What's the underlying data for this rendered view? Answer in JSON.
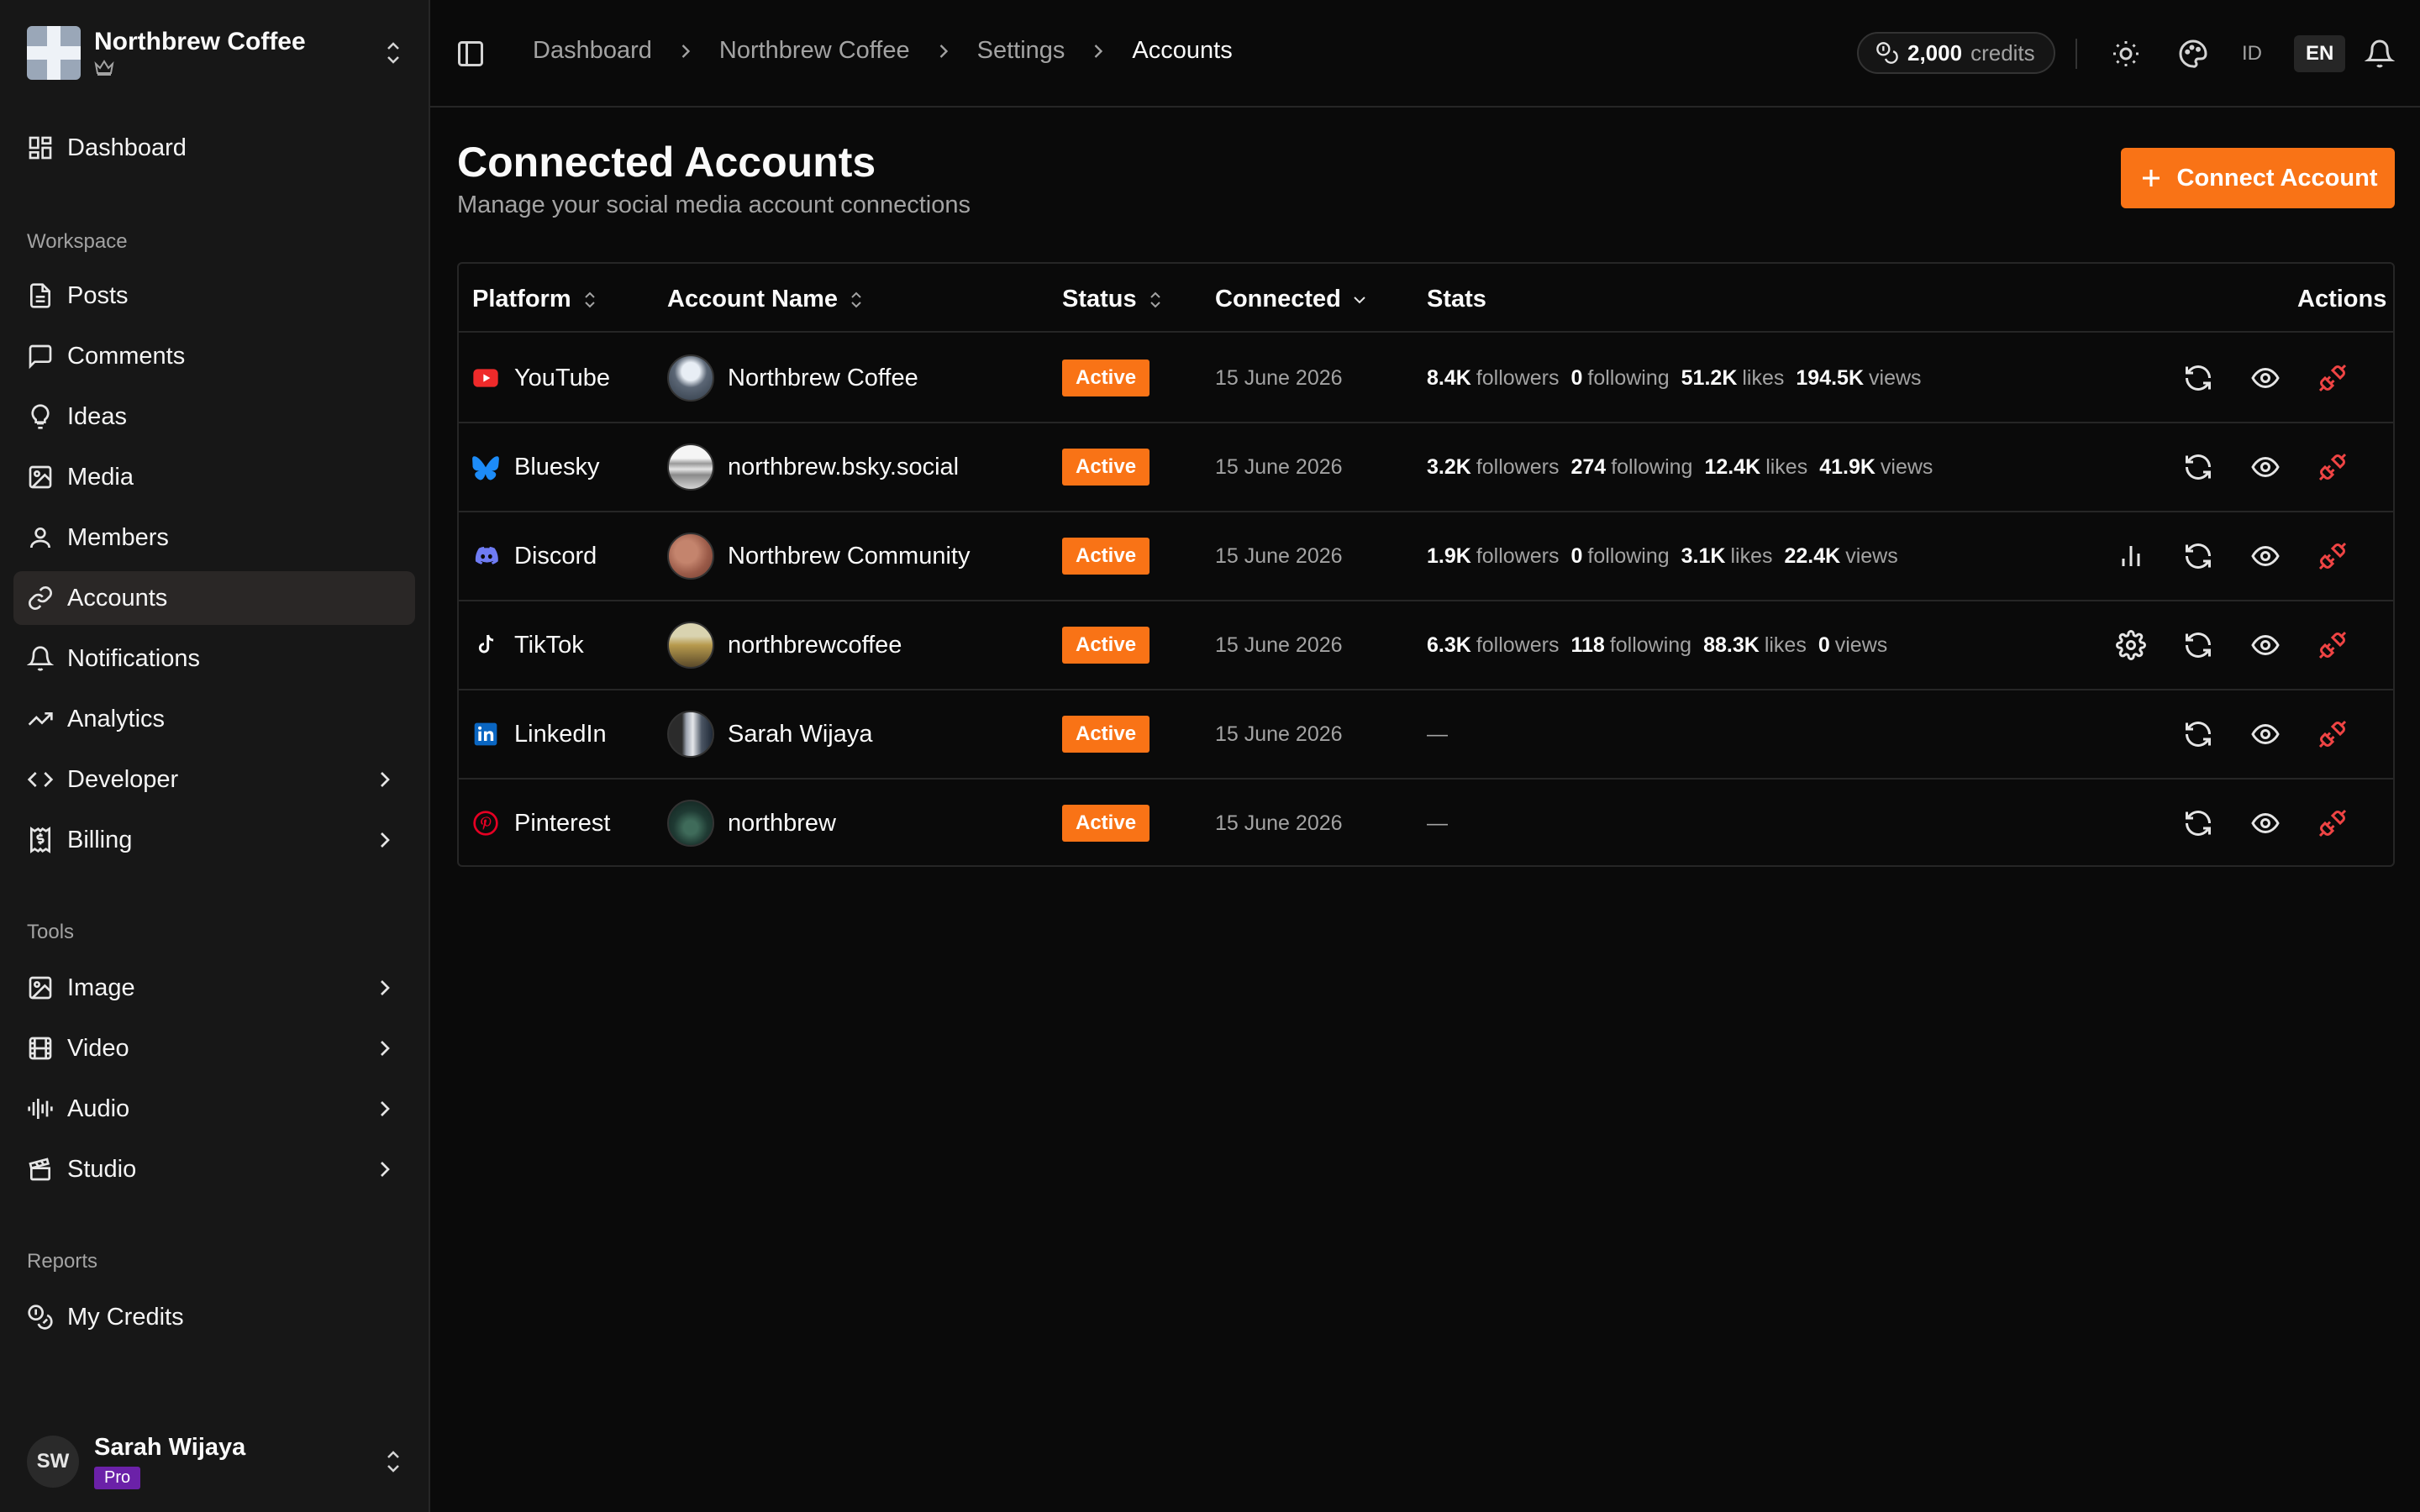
{
  "workspace": {
    "name": "Northbrew Coffee"
  },
  "nav": {
    "dashboard": "Dashboard",
    "workspace_label": "Workspace",
    "posts": "Posts",
    "comments": "Comments",
    "ideas": "Ideas",
    "media": "Media",
    "members": "Members",
    "accounts": "Accounts",
    "notifications": "Notifications",
    "analytics": "Analytics",
    "developer": "Developer",
    "billing": "Billing",
    "tools_label": "Tools",
    "image": "Image",
    "video": "Video",
    "audio": "Audio",
    "studio": "Studio",
    "reports_label": "Reports",
    "my_credits": "My Credits"
  },
  "user": {
    "initials": "SW",
    "name": "Sarah Wijaya",
    "plan": "Pro"
  },
  "breadcrumb": [
    "Dashboard",
    "Northbrew Coffee",
    "Settings",
    "Accounts"
  ],
  "credits": {
    "amount": "2,000",
    "label": "credits"
  },
  "languages": [
    "ID",
    "EN"
  ],
  "page": {
    "title": "Connected Accounts",
    "subtitle": "Manage your social media account connections",
    "connect_button": "Connect Account"
  },
  "table": {
    "headers": {
      "platform": "Platform",
      "account_name": "Account Name",
      "status": "Status",
      "connected": "Connected",
      "stats": "Stats",
      "actions": "Actions"
    },
    "stat_labels": {
      "followers": "followers",
      "following": "following",
      "likes": "likes",
      "views": "views"
    },
    "rows": [
      {
        "platform": "YouTube",
        "account": "Northbrew Coffee",
        "status": "Active",
        "connected": "15 June 2026",
        "followers": "8.4K",
        "following": "0",
        "likes": "51.2K",
        "views": "194.5K"
      },
      {
        "platform": "Bluesky",
        "account": "northbrew.bsky.social",
        "status": "Active",
        "connected": "15 June 2026",
        "followers": "3.2K",
        "following": "274",
        "likes": "12.4K",
        "views": "41.9K"
      },
      {
        "platform": "Discord",
        "account": "Northbrew Community",
        "status": "Active",
        "connected": "15 June 2026",
        "followers": "1.9K",
        "following": "0",
        "likes": "3.1K",
        "views": "22.4K"
      },
      {
        "platform": "TikTok",
        "account": "northbrewcoffee",
        "status": "Active",
        "connected": "15 June 2026",
        "followers": "6.3K",
        "following": "118",
        "likes": "88.3K",
        "views": "0"
      },
      {
        "platform": "LinkedIn",
        "account": "Sarah Wijaya",
        "status": "Active",
        "connected": "15 June 2026",
        "stats_empty": "—"
      },
      {
        "platform": "Pinterest",
        "account": "northbrew",
        "status": "Active",
        "connected": "15 June 2026",
        "stats_empty": "—"
      }
    ]
  },
  "colors": {
    "accent": "#f97316",
    "background": "#0a0a0a",
    "sidebar": "#171717",
    "danger": "#ef4444",
    "pro_badge": "#6b21a8"
  }
}
